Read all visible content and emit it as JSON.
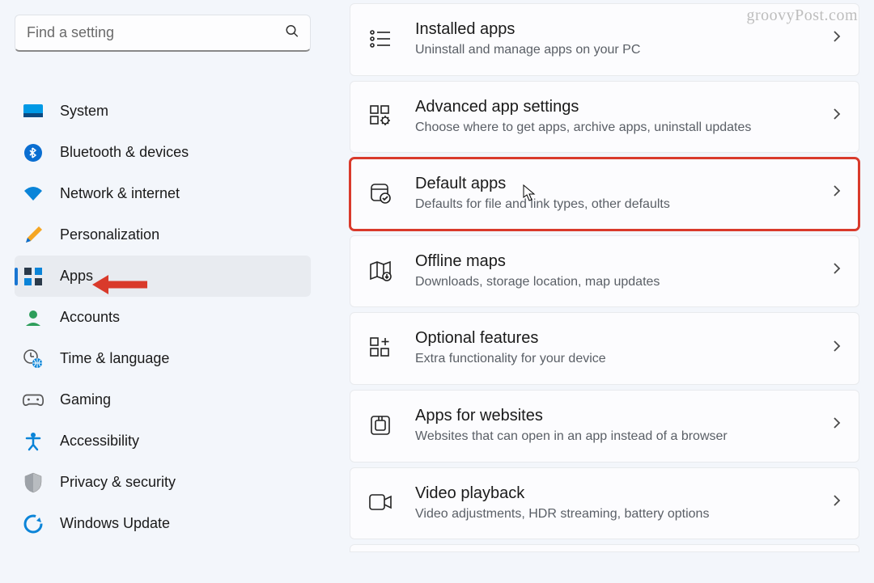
{
  "search": {
    "placeholder": "Find a setting"
  },
  "sidebar": {
    "items": [
      {
        "label": "System"
      },
      {
        "label": "Bluetooth & devices"
      },
      {
        "label": "Network & internet"
      },
      {
        "label": "Personalization"
      },
      {
        "label": "Apps"
      },
      {
        "label": "Accounts"
      },
      {
        "label": "Time & language"
      },
      {
        "label": "Gaming"
      },
      {
        "label": "Accessibility"
      },
      {
        "label": "Privacy & security"
      },
      {
        "label": "Windows Update"
      }
    ]
  },
  "cards": [
    {
      "title": "Installed apps",
      "desc": "Uninstall and manage apps on your PC"
    },
    {
      "title": "Advanced app settings",
      "desc": "Choose where to get apps, archive apps, uninstall updates"
    },
    {
      "title": "Default apps",
      "desc": "Defaults for file and link types, other defaults"
    },
    {
      "title": "Offline maps",
      "desc": "Downloads, storage location, map updates"
    },
    {
      "title": "Optional features",
      "desc": "Extra functionality for your device"
    },
    {
      "title": "Apps for websites",
      "desc": "Websites that can open in an app instead of a browser"
    },
    {
      "title": "Video playback",
      "desc": "Video adjustments, HDR streaming, battery options"
    }
  ],
  "watermark": "groovyPost.com"
}
